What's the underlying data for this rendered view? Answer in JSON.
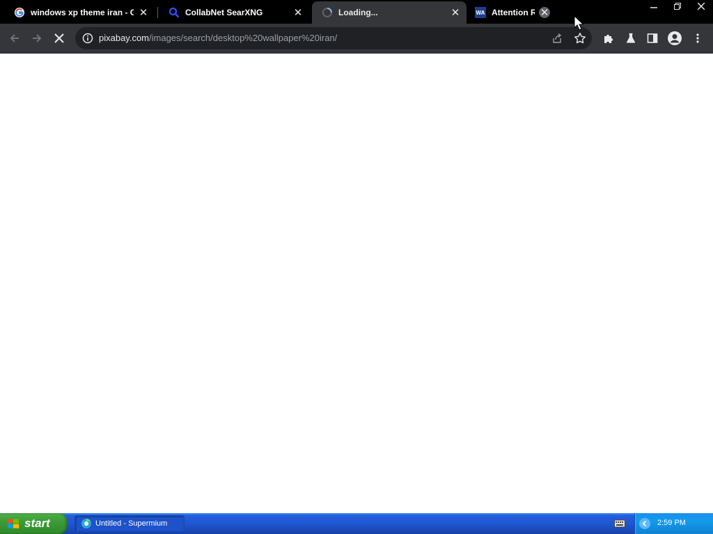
{
  "browser": {
    "tabs": [
      {
        "title": "windows xp theme iran - Go",
        "favicon": "google-g-icon",
        "active": false
      },
      {
        "title": "CollabNet SearXNG",
        "favicon": "searxng-search-icon",
        "active": false
      },
      {
        "title": "Loading...",
        "favicon": "loading-spinner-icon",
        "active": true
      },
      {
        "title": "Attention R",
        "favicon": "wa-icon",
        "active": false
      }
    ],
    "wa_favicon_text": "WA",
    "address_bar": {
      "host": "pixabay.com",
      "path": "/images/search/desktop%20wallpaper%20iran/"
    },
    "toolbar_icons": [
      "back-icon",
      "forward-icon",
      "stop-icon",
      "info-icon",
      "share-icon",
      "star-icon",
      "extensions-icon",
      "labs-icon",
      "side-panel-icon",
      "profile-icon",
      "menu-icon"
    ]
  },
  "taskbar": {
    "start_label": "start",
    "task_items": [
      {
        "label": "Untitled - Supermium",
        "icon": "supermium-icon"
      }
    ],
    "clock": "2:59 PM",
    "colors": {
      "taskbar": "#245edb",
      "start": "#3c9a37",
      "tray": "#139ae8"
    }
  }
}
